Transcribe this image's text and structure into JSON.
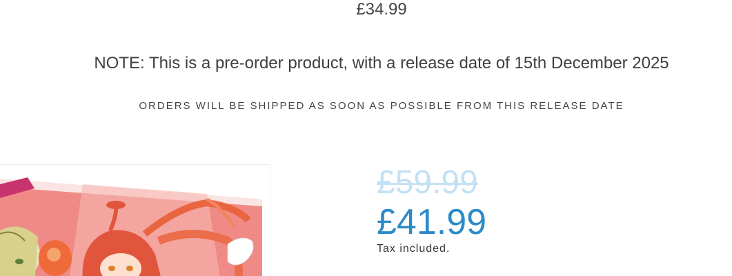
{
  "product": {
    "top_price": "£34.99",
    "preorder_note": "NOTE: This is a pre-order product, with a release date of 15th December 2025",
    "shipping_note": "ORDERS WILL BE SHIPPED AS SOON AS POSSIBLE FROM THIS RELEASE DATE",
    "compare_price": "£59.99",
    "sale_price": "£41.99",
    "tax_note": "Tax included."
  },
  "colors": {
    "sale_price": "#2c8bc7",
    "compare_price": "#c3e1f4"
  }
}
